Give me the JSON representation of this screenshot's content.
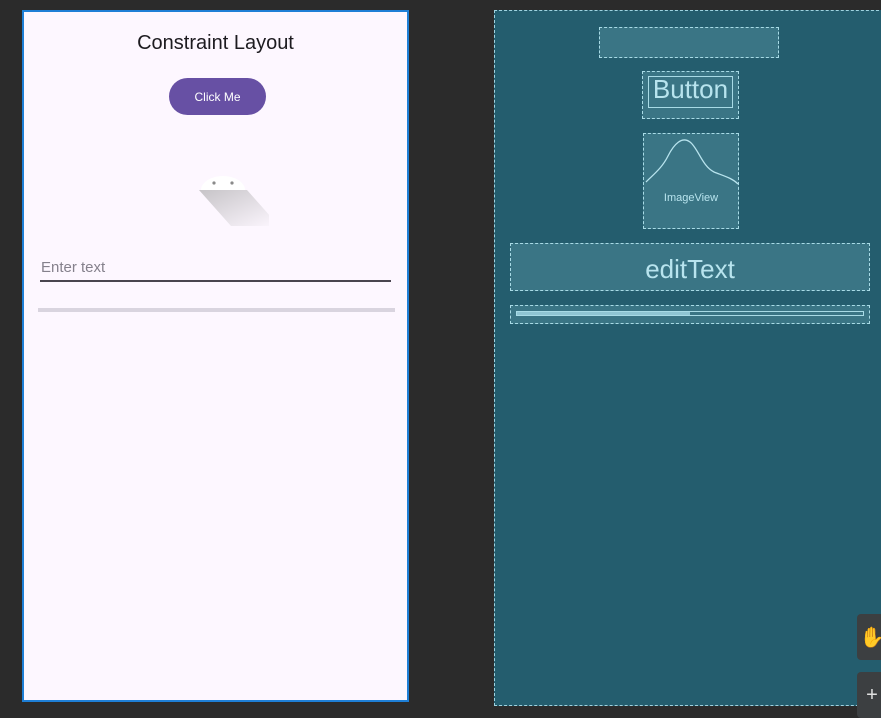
{
  "design": {
    "title": "Constraint Layout",
    "button_label": "Click Me",
    "edit_text_hint": "Enter text",
    "progress_fraction": 0
  },
  "blueprint": {
    "button_label": "Button",
    "image_label": "ImageView",
    "edit_text_label": "editText",
    "progress_fraction": 0.5
  },
  "tools": {
    "pan_icon": "hand-icon",
    "zoom_in_icon": "plus-icon",
    "pan_glyph": "✋",
    "zoom_glyph": "+"
  },
  "colors": {
    "primary": "#6750a4",
    "surface": "#fdf7ff",
    "blueprint_bg": "#245d6e",
    "blueprint_line": "#a8dbe6",
    "selection": "#1e7fd6"
  }
}
